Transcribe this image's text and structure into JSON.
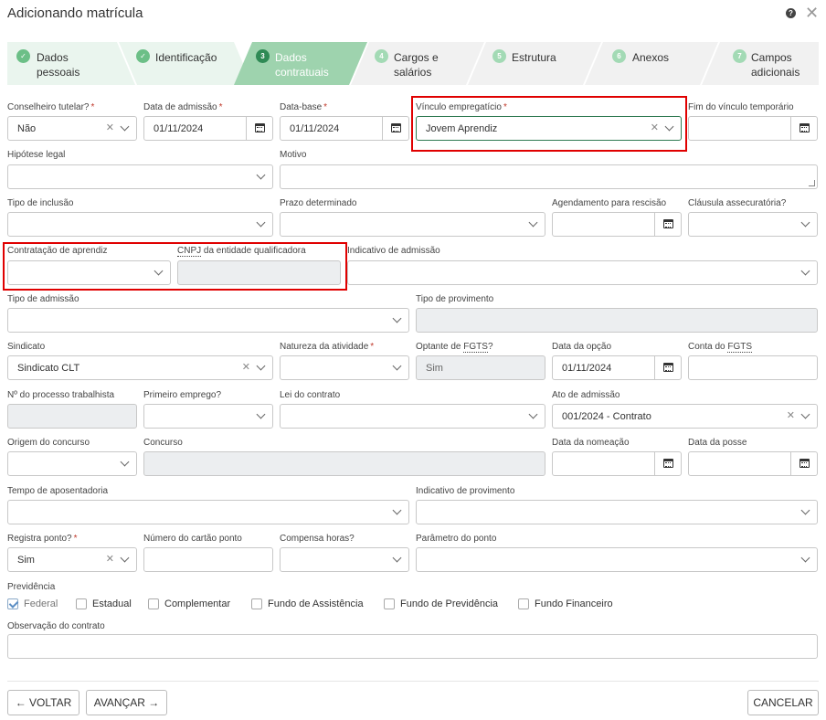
{
  "header": {
    "title": "Adicionando matrícula"
  },
  "steps": [
    {
      "num": "",
      "label": "Dados\npessoais",
      "state": "done"
    },
    {
      "num": "",
      "label": "Identificação",
      "state": "done"
    },
    {
      "num": "3",
      "label": "Dados\ncontratuais",
      "state": "active"
    },
    {
      "num": "4",
      "label": "Cargos e\nsalários",
      "state": "todo"
    },
    {
      "num": "5",
      "label": "Estrutura",
      "state": "todo"
    },
    {
      "num": "6",
      "label": "Anexos",
      "state": "todo"
    },
    {
      "num": "7",
      "label": "Campos\nadicionais",
      "state": "todo"
    }
  ],
  "fields": {
    "conselheiro_tutelar": {
      "label": "Conselheiro tutelar?",
      "value": "Não"
    },
    "data_admissao": {
      "label": "Data de admissão",
      "value": "01/11/2024"
    },
    "data_base": {
      "label": "Data-base",
      "value": "01/11/2024"
    },
    "vinculo_empregaticio": {
      "label": "Vínculo empregatício",
      "value": "Jovem Aprendiz"
    },
    "fim_vinculo_temporario": {
      "label": "Fim do vínculo temporário",
      "value": ""
    },
    "hipotese_legal": {
      "label": "Hipótese legal",
      "value": ""
    },
    "motivo": {
      "label": "Motivo",
      "value": ""
    },
    "tipo_inclusao": {
      "label": "Tipo de inclusão",
      "value": ""
    },
    "prazo_determinado": {
      "label": "Prazo determinado",
      "value": ""
    },
    "agendamento_rescisao": {
      "label": "Agendamento para rescisão",
      "value": ""
    },
    "clausula_assecuratoria": {
      "label": "Cláusula assecuratória?",
      "value": ""
    },
    "contratacao_aprendiz": {
      "label": "Contratação de aprendiz",
      "value": ""
    },
    "cnpj_entidade": {
      "label_a": "CNPJ",
      "label_b": " da entidade qualificadora",
      "value": ""
    },
    "indicativo_admissao": {
      "label": "Indicativo de admissão",
      "value": ""
    },
    "tipo_admissao": {
      "label": "Tipo de admissão",
      "value": ""
    },
    "tipo_provimento": {
      "label": "Tipo de provimento",
      "value": ""
    },
    "sindicato": {
      "label": "Sindicato",
      "value": "Sindicato CLT"
    },
    "natureza_atividade": {
      "label": "Natureza da atividade",
      "value": ""
    },
    "optante_fgts": {
      "label_a": "Optante de ",
      "label_b": "FGTS",
      "label_c": "?",
      "value": "Sim"
    },
    "data_opcao": {
      "label": "Data da opção",
      "value": "01/11/2024"
    },
    "conta_fgts": {
      "label_a": "Conta do ",
      "label_b": "FGTS",
      "value": ""
    },
    "processo_trabalhista": {
      "label": "Nº do processo trabalhista",
      "value": ""
    },
    "primeiro_emprego": {
      "label": "Primeiro emprego?",
      "value": ""
    },
    "lei_contrato": {
      "label": "Lei do contrato",
      "value": ""
    },
    "ato_admissao": {
      "label": "Ato de admissão",
      "value": "001/2024 - Contrato"
    },
    "origem_concurso": {
      "label": "Origem do concurso",
      "value": ""
    },
    "concurso": {
      "label": "Concurso",
      "value": ""
    },
    "data_nomeacao": {
      "label": "Data da nomeação",
      "value": ""
    },
    "data_posse": {
      "label": "Data da posse",
      "value": ""
    },
    "tempo_aposentadoria": {
      "label": "Tempo de aposentadoria",
      "value": ""
    },
    "indicativo_provimento": {
      "label": "Indicativo de provimento",
      "value": ""
    },
    "registra_ponto": {
      "label": "Registra ponto?",
      "value": "Sim"
    },
    "numero_cartao_ponto": {
      "label": "Número do cartão ponto",
      "value": ""
    },
    "compensa_horas": {
      "label": "Compensa horas?",
      "value": ""
    },
    "parametro_ponto": {
      "label": "Parâmetro do ponto",
      "value": ""
    },
    "observacao_contrato": {
      "label": "Observação do contrato",
      "value": ""
    }
  },
  "previdencia": {
    "label": "Previdência",
    "options": [
      {
        "label": "Federal",
        "checked": true
      },
      {
        "label": "Estadual",
        "checked": false
      },
      {
        "label": "Complementar",
        "checked": false
      },
      {
        "label": "Fundo de Assistência",
        "checked": false
      },
      {
        "label": "Fundo de Previdência",
        "checked": false
      },
      {
        "label": "Fundo Financeiro",
        "checked": false
      }
    ]
  },
  "footer": {
    "voltar": "VOLTAR",
    "avancar": "AVANÇAR",
    "cancelar": "CANCELAR"
  },
  "colors": {
    "done_bg": "#eaf5ee",
    "done_icon": "#6cbf87",
    "active_bg": "#9ed3ae",
    "active_icon": "#2f8a55",
    "todo_bg": "#f1f1f1",
    "todo_icon": "#a3dab5",
    "highlight": "#e00000"
  }
}
